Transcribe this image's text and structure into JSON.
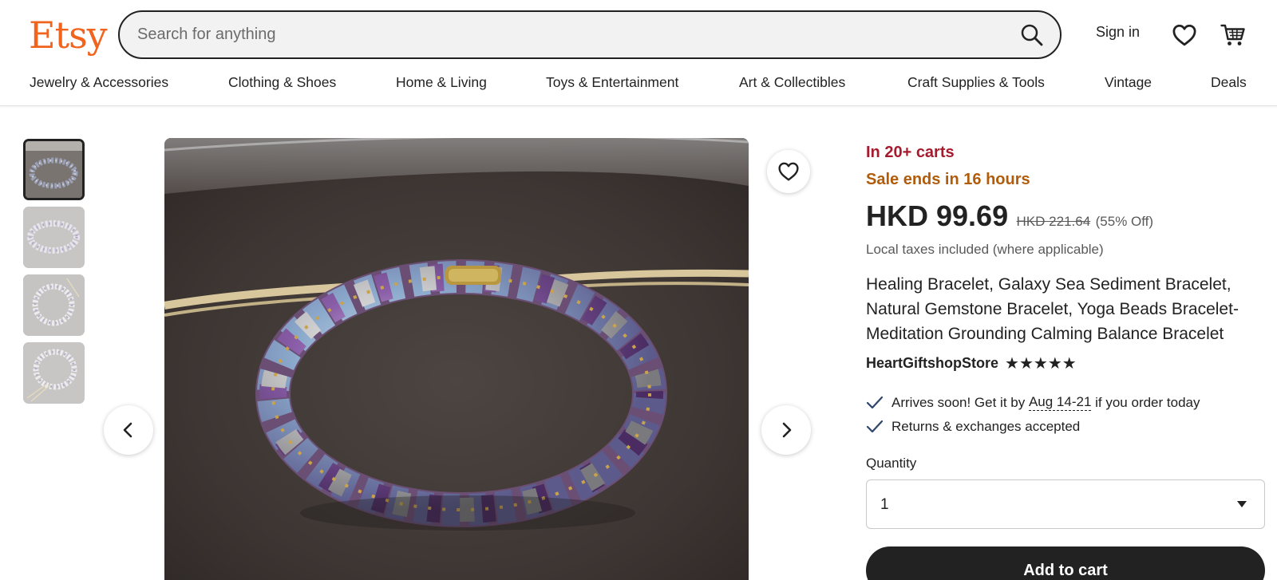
{
  "header": {
    "logo": "Etsy",
    "search_placeholder": "Search for anything",
    "sign_in": "Sign in",
    "nav": [
      "Jewelry & Accessories",
      "Clothing & Shoes",
      "Home & Living",
      "Toys & Entertainment",
      "Art & Collectibles",
      "Craft Supplies & Tools",
      "Vintage",
      "Deals"
    ]
  },
  "gallery": {
    "thumbnail_count": 4,
    "active_thumbnail": 1
  },
  "listing": {
    "in_carts": "In 20+ carts",
    "sale_ends": "Sale ends in 16 hours",
    "price": "HKD 99.69",
    "original_price": "HKD 221.64",
    "discount": "(55% Off)",
    "taxes_note": "Local taxes included (where applicable)",
    "title": "Healing Bracelet, Galaxy Sea Sediment Bracelet, Natural Gemstone Bracelet, Yoga Beads Bracelet-Meditation Grounding Calming Balance Bracelet",
    "shop_name": "HeartGiftshopStore",
    "rating": 5,
    "stars": "★★★★★",
    "arrives_prefix": "Arrives soon! Get it by ",
    "arrives_dates": "Aug 14-21",
    "arrives_suffix": " if you order today",
    "returns": "Returns & exchanges accepted",
    "quantity_label": "Quantity",
    "quantity_value": "1",
    "add_to_cart": "Add to cart"
  },
  "colors": {
    "brand": "#f1641e",
    "in_carts": "#a61a2e",
    "sale": "#b15c0a",
    "check": "#2f466c",
    "button": "#222222"
  }
}
